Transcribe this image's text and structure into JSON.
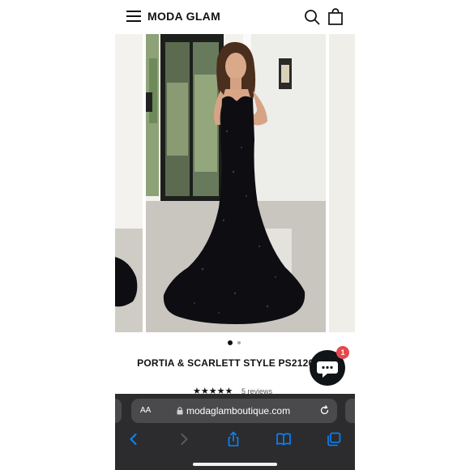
{
  "header": {
    "brand": "MODA GLAM",
    "menu_icon": "hamburger-menu-icon",
    "search_icon": "search-icon",
    "cart_icon": "shopping-bag-icon"
  },
  "gallery": {
    "slide_count": 2,
    "active_slide": 1,
    "zoom_icon": "zoom-icon"
  },
  "product": {
    "title": "PORTIA & SCARLETT STYLE PS21208- B",
    "stars": "★★★★★",
    "reviews": "5 reviews"
  },
  "chat": {
    "icon": "chat-bubble-icon",
    "badge": "1"
  },
  "browser": {
    "text_size": "AA",
    "url": "modaglamboutique.com",
    "lock_icon": "lock-icon",
    "reload_icon": "reload-icon",
    "toolbar": [
      "back-icon",
      "forward-icon",
      "share-icon",
      "bookmarks-icon",
      "tabs-icon"
    ]
  },
  "colors": {
    "accent_blue": "#0a84ff",
    "browser_bg": "#2c2c2e",
    "badge_red": "#e5484d",
    "dress": "#0d0d12"
  }
}
